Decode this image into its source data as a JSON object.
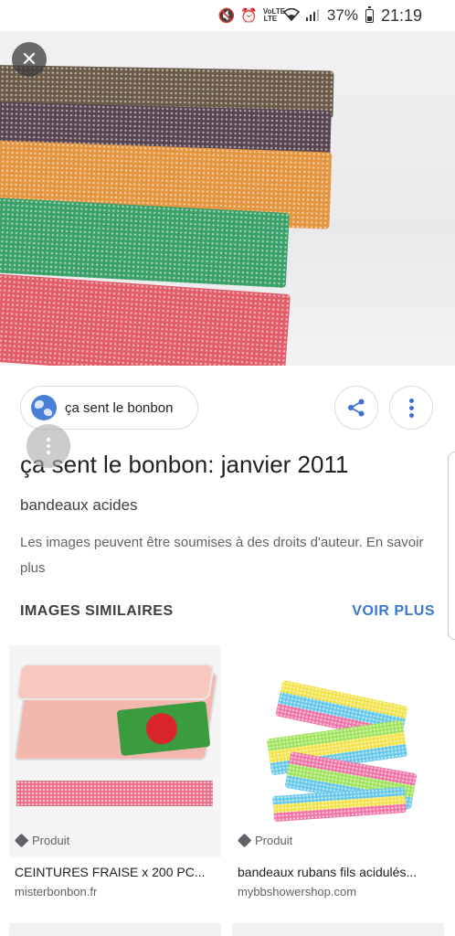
{
  "status_bar": {
    "mute_icon": "mute-icon",
    "alarm_icon": "alarm-icon",
    "volte_label": "VoLTE",
    "lte_label": "LTE",
    "wifi_icon": "wifi-icon",
    "signal_icon": "signal-icon",
    "battery_percent": "37%",
    "time": "21:19"
  },
  "viewer": {
    "close_icon": "close-icon",
    "source_label": "ça sent le bonbon",
    "title": "ça sent le bonbon: janvier 2011",
    "subtitle": "bandeaux acides",
    "copyright_text": "Les images peuvent être soumises à des droits d'auteur.",
    "copyright_link": "En savoir plus"
  },
  "similar": {
    "header": "IMAGES SIMILAIRES",
    "see_more": "VOIR PLUS",
    "items": [
      {
        "badge": "Produit",
        "title": "CEINTURES FRAISE x 200 PC...",
        "domain": "misterbonbon.fr"
      },
      {
        "badge": "Produit",
        "title": "bandeaux rubans fils acidulés...",
        "domain": "mybbshowershop.com"
      }
    ]
  },
  "colors": {
    "accent": "#3b78c9",
    "text_primary": "#202124",
    "text_secondary": "#5f6368"
  }
}
